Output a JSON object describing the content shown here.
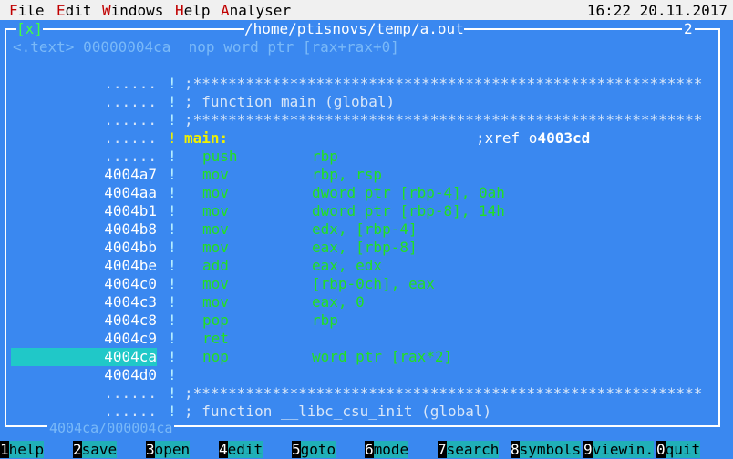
{
  "menubar": {
    "items": [
      {
        "hot": "F",
        "rest": "ile"
      },
      {
        "hot": "E",
        "rest": "dit"
      },
      {
        "hot": "W",
        "rest": "indows"
      },
      {
        "hot": "H",
        "rest": "elp"
      },
      {
        "hot": "A",
        "rest": "nalyser"
      }
    ],
    "clock": "16:22 20.11.2017"
  },
  "window": {
    "close_label": "[x]",
    "title": "/home/ptisnovs/temp/a.out",
    "number": "2"
  },
  "hint": "<.text> 00000004ca  nop word ptr [rax+rax+0]",
  "disasm": {
    "rows": [
      {
        "addr": "......",
        "sep": "!",
        "comment": ";**********************************************************"
      },
      {
        "addr": "......",
        "sep": "!",
        "comment": "; function main (global)"
      },
      {
        "addr": "......",
        "sep": "!",
        "comment": ";**********************************************************"
      },
      {
        "addr": "......",
        "sep": "!",
        "label": "main:",
        "xref_prefix": ";xref o",
        "xref_addr": "4003cd"
      },
      {
        "addr": "......",
        "sep": "!",
        "mnemonic": "push",
        "operands": "rbp"
      },
      {
        "addr": "4004a7",
        "sep": "!",
        "mnemonic": "mov",
        "operands": "rbp, rsp"
      },
      {
        "addr": "4004aa",
        "sep": "!",
        "mnemonic": "mov",
        "operands": "dword ptr [rbp-4], 0ah"
      },
      {
        "addr": "4004b1",
        "sep": "!",
        "mnemonic": "mov",
        "operands": "dword ptr [rbp-8], 14h"
      },
      {
        "addr": "4004b8",
        "sep": "!",
        "mnemonic": "mov",
        "operands": "edx, [rbp-4]"
      },
      {
        "addr": "4004bb",
        "sep": "!",
        "mnemonic": "mov",
        "operands": "eax, [rbp-8]"
      },
      {
        "addr": "4004be",
        "sep": "!",
        "mnemonic": "add",
        "operands": "eax, edx"
      },
      {
        "addr": "4004c0",
        "sep": "!",
        "mnemonic": "mov",
        "operands": "[rbp-0ch], eax"
      },
      {
        "addr": "4004c3",
        "sep": "!",
        "mnemonic": "mov",
        "operands": "eax, 0"
      },
      {
        "addr": "4004c8",
        "sep": "!",
        "mnemonic": "pop",
        "operands": "rbp"
      },
      {
        "addr": "4004c9",
        "sep": "!",
        "mnemonic": "ret",
        "operands": ""
      },
      {
        "addr": "4004ca",
        "sep": "!",
        "mnemonic": "nop",
        "operands": "word ptr [rax*2]"
      },
      {
        "addr": "4004d0",
        "sep": "!"
      },
      {
        "addr": "......",
        "sep": "!",
        "comment": ";**********************************************************"
      },
      {
        "addr": "......",
        "sep": "!",
        "comment": "; function __libc_csu_init (global)"
      }
    ]
  },
  "status": "4004ca/000004ca",
  "fkeys": [
    {
      "n": "1",
      "label": "help"
    },
    {
      "n": "2",
      "label": "save"
    },
    {
      "n": "3",
      "label": "open"
    },
    {
      "n": "4",
      "label": "edit"
    },
    {
      "n": "5",
      "label": "goto"
    },
    {
      "n": "6",
      "label": "mode"
    },
    {
      "n": "7",
      "label": "search"
    },
    {
      "n": "8",
      "label": "symbols"
    },
    {
      "n": "9",
      "label": "viewin."
    },
    {
      "n": "0",
      "label": "quit"
    }
  ],
  "colors": {
    "background": "#3a88f0",
    "mnemonic": "#22e022",
    "label": "#f0f000",
    "selection": "#20c8c8",
    "fkey_label_bg": "#20b0b8"
  }
}
